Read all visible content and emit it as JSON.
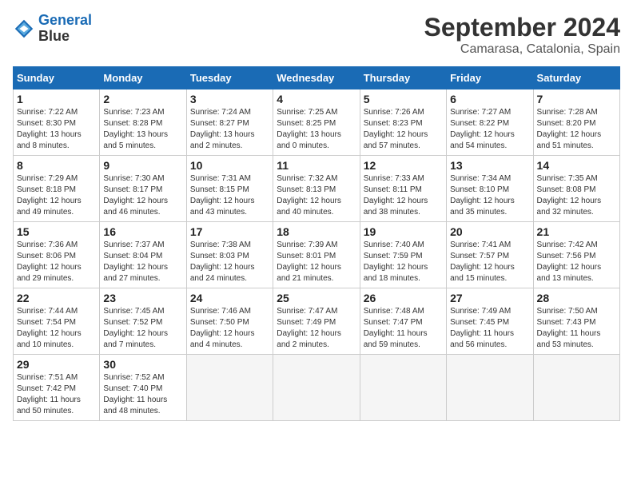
{
  "header": {
    "logo_line1": "General",
    "logo_line2": "Blue",
    "month": "September 2024",
    "location": "Camarasa, Catalonia, Spain"
  },
  "weekdays": [
    "Sunday",
    "Monday",
    "Tuesday",
    "Wednesday",
    "Thursday",
    "Friday",
    "Saturday"
  ],
  "weeks": [
    [
      {
        "day": "1",
        "info": "Sunrise: 7:22 AM\nSunset: 8:30 PM\nDaylight: 13 hours\nand 8 minutes."
      },
      {
        "day": "2",
        "info": "Sunrise: 7:23 AM\nSunset: 8:28 PM\nDaylight: 13 hours\nand 5 minutes."
      },
      {
        "day": "3",
        "info": "Sunrise: 7:24 AM\nSunset: 8:27 PM\nDaylight: 13 hours\nand 2 minutes."
      },
      {
        "day": "4",
        "info": "Sunrise: 7:25 AM\nSunset: 8:25 PM\nDaylight: 13 hours\nand 0 minutes."
      },
      {
        "day": "5",
        "info": "Sunrise: 7:26 AM\nSunset: 8:23 PM\nDaylight: 12 hours\nand 57 minutes."
      },
      {
        "day": "6",
        "info": "Sunrise: 7:27 AM\nSunset: 8:22 PM\nDaylight: 12 hours\nand 54 minutes."
      },
      {
        "day": "7",
        "info": "Sunrise: 7:28 AM\nSunset: 8:20 PM\nDaylight: 12 hours\nand 51 minutes."
      }
    ],
    [
      {
        "day": "8",
        "info": "Sunrise: 7:29 AM\nSunset: 8:18 PM\nDaylight: 12 hours\nand 49 minutes."
      },
      {
        "day": "9",
        "info": "Sunrise: 7:30 AM\nSunset: 8:17 PM\nDaylight: 12 hours\nand 46 minutes."
      },
      {
        "day": "10",
        "info": "Sunrise: 7:31 AM\nSunset: 8:15 PM\nDaylight: 12 hours\nand 43 minutes."
      },
      {
        "day": "11",
        "info": "Sunrise: 7:32 AM\nSunset: 8:13 PM\nDaylight: 12 hours\nand 40 minutes."
      },
      {
        "day": "12",
        "info": "Sunrise: 7:33 AM\nSunset: 8:11 PM\nDaylight: 12 hours\nand 38 minutes."
      },
      {
        "day": "13",
        "info": "Sunrise: 7:34 AM\nSunset: 8:10 PM\nDaylight: 12 hours\nand 35 minutes."
      },
      {
        "day": "14",
        "info": "Sunrise: 7:35 AM\nSunset: 8:08 PM\nDaylight: 12 hours\nand 32 minutes."
      }
    ],
    [
      {
        "day": "15",
        "info": "Sunrise: 7:36 AM\nSunset: 8:06 PM\nDaylight: 12 hours\nand 29 minutes."
      },
      {
        "day": "16",
        "info": "Sunrise: 7:37 AM\nSunset: 8:04 PM\nDaylight: 12 hours\nand 27 minutes."
      },
      {
        "day": "17",
        "info": "Sunrise: 7:38 AM\nSunset: 8:03 PM\nDaylight: 12 hours\nand 24 minutes."
      },
      {
        "day": "18",
        "info": "Sunrise: 7:39 AM\nSunset: 8:01 PM\nDaylight: 12 hours\nand 21 minutes."
      },
      {
        "day": "19",
        "info": "Sunrise: 7:40 AM\nSunset: 7:59 PM\nDaylight: 12 hours\nand 18 minutes."
      },
      {
        "day": "20",
        "info": "Sunrise: 7:41 AM\nSunset: 7:57 PM\nDaylight: 12 hours\nand 15 minutes."
      },
      {
        "day": "21",
        "info": "Sunrise: 7:42 AM\nSunset: 7:56 PM\nDaylight: 12 hours\nand 13 minutes."
      }
    ],
    [
      {
        "day": "22",
        "info": "Sunrise: 7:44 AM\nSunset: 7:54 PM\nDaylight: 12 hours\nand 10 minutes."
      },
      {
        "day": "23",
        "info": "Sunrise: 7:45 AM\nSunset: 7:52 PM\nDaylight: 12 hours\nand 7 minutes."
      },
      {
        "day": "24",
        "info": "Sunrise: 7:46 AM\nSunset: 7:50 PM\nDaylight: 12 hours\nand 4 minutes."
      },
      {
        "day": "25",
        "info": "Sunrise: 7:47 AM\nSunset: 7:49 PM\nDaylight: 12 hours\nand 2 minutes."
      },
      {
        "day": "26",
        "info": "Sunrise: 7:48 AM\nSunset: 7:47 PM\nDaylight: 11 hours\nand 59 minutes."
      },
      {
        "day": "27",
        "info": "Sunrise: 7:49 AM\nSunset: 7:45 PM\nDaylight: 11 hours\nand 56 minutes."
      },
      {
        "day": "28",
        "info": "Sunrise: 7:50 AM\nSunset: 7:43 PM\nDaylight: 11 hours\nand 53 minutes."
      }
    ],
    [
      {
        "day": "29",
        "info": "Sunrise: 7:51 AM\nSunset: 7:42 PM\nDaylight: 11 hours\nand 50 minutes."
      },
      {
        "day": "30",
        "info": "Sunrise: 7:52 AM\nSunset: 7:40 PM\nDaylight: 11 hours\nand 48 minutes."
      },
      null,
      null,
      null,
      null,
      null
    ]
  ]
}
